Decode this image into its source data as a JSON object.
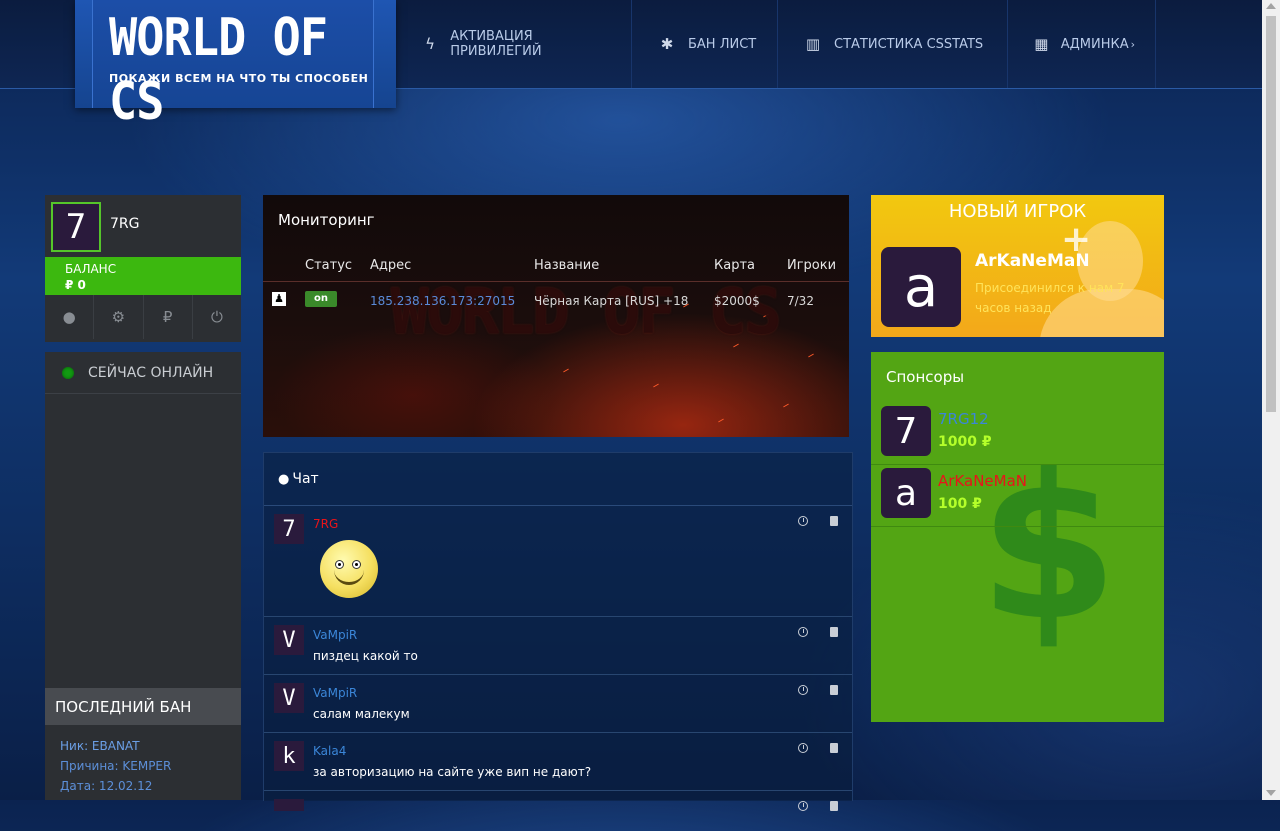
{
  "header": {
    "logo_title": "WORLD OF CS",
    "logo_subtitle": "ПОКАЖИ ВСЕМ НА ЧТО ТЫ СПОСОБЕН",
    "nav": [
      {
        "label": "АКТИВАЦИЯ ПРИВИЛЕГИЙ",
        "icon": "bolt-icon"
      },
      {
        "label": "БАН ЛИСТ",
        "icon": "bug-icon"
      },
      {
        "label": "СТАТИСТИКА CSSTATS",
        "icon": "bar-chart-icon"
      },
      {
        "label": "АДМИНКА",
        "icon": "table-icon"
      }
    ]
  },
  "user": {
    "avatar_letter": "7",
    "name": "7RG",
    "balance_label": "БАЛАНС",
    "balance_value": "₽ 0"
  },
  "online": {
    "title": "СЕЙЧАС ОНЛАЙН"
  },
  "last_ban": {
    "title": "ПОСЛЕДНИЙ БАН",
    "nick": "Ник: EBANAT",
    "reason": "Причина: KEMPER",
    "date": "Дата: 12.02.12"
  },
  "monitoring": {
    "title": "Мониторинг",
    "watermark": "WORLD OF CS",
    "columns": [
      "Статус",
      "Адрес",
      "Название",
      "Карта",
      "Игроки"
    ],
    "row": {
      "status": "on",
      "address": "185.238.136.173:27015",
      "name": "Чёрная Карта [RUS] +18",
      "map": "$2000$",
      "players": "7/32"
    }
  },
  "chat": {
    "title": "Чат",
    "messages": [
      {
        "avatar": "7",
        "nick": "7RG",
        "text": "",
        "nick_color": "#e8141a"
      },
      {
        "avatar": "V",
        "nick": "VaMpiR",
        "text": "пиздец какой то",
        "nick_color": "#3b86d8"
      },
      {
        "avatar": "V",
        "nick": "VaMpiR",
        "text": "салам малекум",
        "nick_color": "#3b86d8"
      },
      {
        "avatar": "k",
        "nick": "Kala4",
        "text": "за авторизацию на сайте уже вип не дают?",
        "nick_color": "#3b86d8"
      }
    ]
  },
  "new_player": {
    "title": "НОВЫЙ ИГРОК",
    "avatar": "a",
    "name": "ArKaNeMaN",
    "joined": "Присоединился к нам 7 часов назад"
  },
  "sponsors": {
    "title": "Спонсоры",
    "items": [
      {
        "avatar": "7",
        "name": "7RG12",
        "amount": "1000 ₽",
        "name_color": "#3b86d8"
      },
      {
        "avatar": "a",
        "name": "ArKaNeMaN",
        "amount": "100 ₽",
        "name_color": "#e8141a"
      }
    ]
  }
}
